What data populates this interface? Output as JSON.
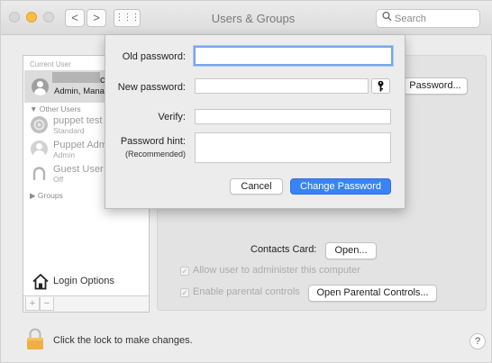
{
  "window": {
    "title": "Users & Groups",
    "search_placeholder": "Search",
    "nav_back": "<",
    "nav_forward": ">",
    "grid_glyph": "⋮⋮⋮"
  },
  "sidebar": {
    "current_user_label": "Current User",
    "current_user": {
      "name_suffix": "c",
      "role": "Admin, Manag"
    },
    "other_users_label": "Other Users",
    "other_users": [
      {
        "name": "puppet test",
        "role": "Standard"
      },
      {
        "name": "Puppet Adm",
        "role": "Admin"
      },
      {
        "name": "Guest User",
        "role": "Off"
      }
    ],
    "groups_label": "Groups",
    "login_options_label": "Login Options",
    "add_label": "+",
    "remove_label": "−"
  },
  "panel": {
    "change_password_label": "Password...",
    "contacts_card_label": "Contacts Card:",
    "open_label": "Open...",
    "allow_admin_label": "Allow user to administer this computer",
    "allow_admin_checked": true,
    "parental_label": "Enable parental controls",
    "parental_checked": true,
    "open_parental_label": "Open Parental Controls..."
  },
  "footer": {
    "lock_text": "Click the lock to make changes.",
    "help_label": "?"
  },
  "dialog": {
    "old_password_label": "Old password:",
    "new_password_label": "New password:",
    "verify_label": "Verify:",
    "hint_label": "Password hint:",
    "hint_sub_label": "(Recommended)",
    "old_password_value": "",
    "new_password_value": "",
    "verify_value": "",
    "hint_value": "",
    "cancel_label": "Cancel",
    "change_label": "Change Password"
  },
  "colors": {
    "accent": "#3a82f7",
    "lock": "#f0b041",
    "close_light": "#d8d8d8",
    "minimize_light": "#fdbc40"
  },
  "icons": {
    "lock": "lock-icon",
    "home": "house-icon",
    "key": "key-icon",
    "search": "search-icon"
  }
}
